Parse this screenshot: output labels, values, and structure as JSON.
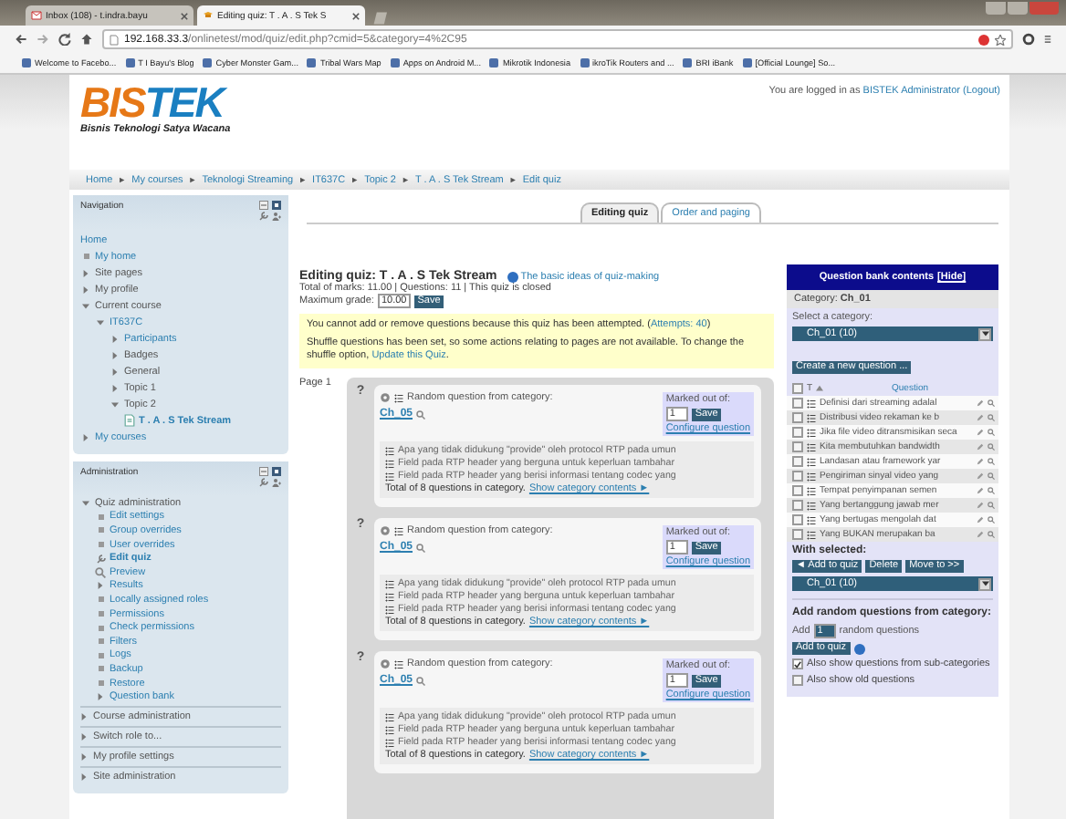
{
  "browser": {
    "tabs": [
      {
        "kind": "mail",
        "title": "Inbox (108) - t.indra.bayu",
        "selected": false
      },
      {
        "kind": "course",
        "title": "Editing quiz: T . A . S Tek S",
        "selected": true
      }
    ],
    "url_host": "192.168.33.3",
    "url_path": "/onlinetest/mod/quiz/edit.php?cmid=5&category=4%2C95",
    "bookmarks": [
      "Welcome to Facebo...",
      "T I Bayu's Blog",
      "Cyber Monster Gam...",
      "Tribal Wars Map",
      "Apps on Android M...",
      "Mikrotik Indonesia",
      "ikroTik Routers and ...",
      "BRI iBank",
      "[Official Lounge] So..."
    ]
  },
  "header": {
    "logo_a": "BIS",
    "logo_b": "TEK",
    "tagline": "Bisnis Teknologi Satya Wacana",
    "login_text": "You are logged in as",
    "user": "BISTEK Administrator",
    "logout": "(Logout)"
  },
  "breadcrumb": {
    "separator": "►",
    "items": [
      "Home",
      "My courses",
      "Teknologi Streaming",
      "IT637C",
      "Topic 2",
      "T . A . S Tek Stream",
      "Edit quiz"
    ]
  },
  "navigation": {
    "title": "Navigation",
    "items": [
      {
        "kind": "none",
        "label": "Home",
        "link": true,
        "current": false
      },
      {
        "kind": "bullet",
        "label": "My home",
        "link": true,
        "current": false
      },
      {
        "kind": "branch",
        "label": "Site pages",
        "link": false,
        "current": false,
        "expanded": false
      },
      {
        "kind": "branch",
        "label": "My profile",
        "link": false,
        "current": false,
        "expanded": false
      },
      {
        "kind": "branch",
        "label": "Current course",
        "link": false,
        "current": false,
        "expanded": true,
        "children": [
          {
            "kind": "branch",
            "label": "IT637C",
            "link": true,
            "current": false,
            "expanded": true,
            "children": [
              {
                "kind": "branch",
                "label": "Participants",
                "link": true,
                "current": false,
                "expanded": false
              },
              {
                "kind": "branch",
                "label": "Badges",
                "link": false,
                "current": false,
                "expanded": false
              },
              {
                "kind": "branch",
                "label": "General",
                "link": false,
                "current": false,
                "expanded": false
              },
              {
                "kind": "branch",
                "label": "Topic 1",
                "link": false,
                "current": false,
                "expanded": false
              },
              {
                "kind": "branch",
                "label": "Topic 2",
                "link": false,
                "current": false,
                "expanded": true,
                "children": [
                  {
                    "kind": "page",
                    "label": "T . A . S Tek Stream",
                    "link": true,
                    "current": true
                  }
                ]
              }
            ]
          }
        ]
      },
      {
        "kind": "branch",
        "label": "My courses",
        "link": true,
        "current": false,
        "expanded": false
      }
    ]
  },
  "administration": {
    "title": "Administration",
    "items": [
      {
        "kind": "branch",
        "label": "Quiz administration",
        "link": false,
        "current": false,
        "expanded": true,
        "children": [
          {
            "kind": "bullet",
            "label": "Edit settings",
            "link": true,
            "current": false
          },
          {
            "kind": "bullet",
            "label": "Group overrides",
            "link": true,
            "current": false
          },
          {
            "kind": "bullet",
            "label": "User overrides",
            "link": true,
            "current": false
          },
          {
            "kind": "edit",
            "label": "Edit quiz",
            "link": true,
            "current": true
          },
          {
            "kind": "preview",
            "label": "Preview",
            "link": true,
            "current": false
          },
          {
            "kind": "branch",
            "label": "Results",
            "link": true,
            "current": false,
            "expanded": false
          },
          {
            "kind": "bullet",
            "label": "Locally assigned roles",
            "link": true,
            "current": false
          },
          {
            "kind": "bullet",
            "label": "Permissions",
            "link": true,
            "current": false
          },
          {
            "kind": "bullet",
            "label": "Check permissions",
            "link": true,
            "current": false
          },
          {
            "kind": "bullet",
            "label": "Filters",
            "link": true,
            "current": false
          },
          {
            "kind": "bullet",
            "label": "Logs",
            "link": true,
            "current": false
          },
          {
            "kind": "bullet",
            "label": "Backup",
            "link": true,
            "current": false
          },
          {
            "kind": "bullet",
            "label": "Restore",
            "link": true,
            "current": false
          },
          {
            "kind": "branch",
            "label": "Question bank",
            "link": true,
            "current": false,
            "expanded": false
          }
        ]
      }
    ],
    "sections": [
      "Course administration",
      "Switch role to...",
      "My profile settings",
      "Site administration"
    ]
  },
  "quiz_tabs": [
    {
      "label": "Editing quiz",
      "selected": true
    },
    {
      "label": "Order and paging",
      "selected": false
    }
  ],
  "quiz": {
    "title": "Editing quiz: T . A . S Tek Stream",
    "help_link": "The basic ideas of quiz-making",
    "totals": "Total of marks: 11.00 | Questions: 11 | This quiz is closed",
    "max_grade_label": "Maximum grade:",
    "max_grade": "10.00",
    "save": "Save",
    "notice_1": "You cannot add or remove questions because this quiz has been attempted. (",
    "notice_1_link": "Attempts: 40",
    "notice_1_end": ")",
    "notice_2": "Shuffle questions has been set, so some actions relating to pages are not available. To change the shuffle option,",
    "notice_2_link": "Update this Quiz",
    "notice_2_end": "."
  },
  "page_label": "Page 1",
  "questions": [
    {
      "marker": "?",
      "title": "Random question from category:",
      "category": "Ch_05",
      "marked_label": "Marked out of:",
      "mark": "1",
      "save": "Save",
      "configure": "Configure question",
      "samples": [
        "Apa yang tidak didukung \"provide\" oleh protocol RTP pada umun",
        "Field pada RTP header yang berguna untuk keperluan tambahar",
        "Field pada RTP header yang berisi informasi tentang codec yang"
      ],
      "total": "Total of 8 questions in category.",
      "show": "Show category contents ►"
    },
    {
      "marker": "?",
      "title": "Random question from category:",
      "category": "Ch_05",
      "marked_label": "Marked out of:",
      "mark": "1",
      "save": "Save",
      "configure": "Configure question",
      "samples": [
        "Apa yang tidak didukung \"provide\" oleh protocol RTP pada umun",
        "Field pada RTP header yang berguna untuk keperluan tambahar",
        "Field pada RTP header yang berisi informasi tentang codec yang"
      ],
      "total": "Total of 8 questions in category.",
      "show": "Show category contents ►"
    },
    {
      "marker": "?",
      "title": "Random question from category:",
      "category": "Ch_05",
      "marked_label": "Marked out of:",
      "mark": "1",
      "save": "Save",
      "configure": "Configure question",
      "samples": [
        "Apa yang tidak didukung \"provide\" oleh protocol RTP pada umun",
        "Field pada RTP header yang berguna untuk keperluan tambahar",
        "Field pada RTP header yang berisi informasi tentang codec yang"
      ],
      "total": "Total of 8 questions in category.",
      "show": "Show category contents ►"
    }
  ],
  "bank": {
    "title": "Question bank contents",
    "hide": "[Hide]",
    "category": "Category: **Ch_01**",
    "select_label": "Select a category:",
    "select_value": "Ch_01 (10)",
    "create": "Create a new question ...",
    "select_all_checked": false,
    "col_type": "T",
    "col_question": "Question",
    "rows": [
      {
        "text": "Definisi dari streaming adalal",
        "checked": false
      },
      {
        "text": "Distribusi video rekaman ke b",
        "checked": false
      },
      {
        "text": "Jika file video ditransmisikan seca",
        "checked": false
      },
      {
        "text": "Kita membutuhkan bandwidth",
        "checked": false
      },
      {
        "text": "Landasan atau framework yar",
        "checked": false
      },
      {
        "text": "Pengiriman sinyal video yang",
        "checked": false
      },
      {
        "text": "Tempat penyimpanan semen",
        "checked": false
      },
      {
        "text": "Yang bertanggung jawab mer",
        "checked": false
      },
      {
        "text": "Yang bertugas mengolah dat",
        "checked": false
      },
      {
        "text": "Yang BUKAN merupakan ba",
        "checked": false
      }
    ],
    "with_selected": "With selected:",
    "add_to_quiz": "◄ Add to quiz",
    "delete": "Delete",
    "move": "Move to >>",
    "move_target": "Ch_01 (10)",
    "random_title": "Add random questions from category:",
    "add_label": "Add",
    "add_count": "1",
    "add_suffix": "random questions",
    "random_add": "Add to quiz",
    "options": [
      {
        "label": "Also show questions from sub-categories",
        "checked": true
      },
      {
        "label": "Also show old questions",
        "checked": false
      }
    ]
  }
}
